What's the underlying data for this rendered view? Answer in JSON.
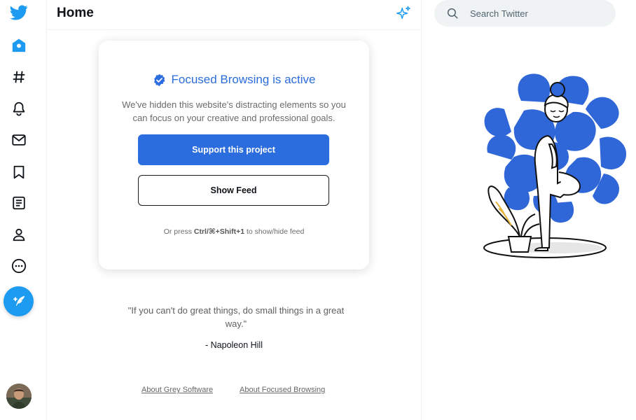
{
  "sidebar": {
    "icons": [
      "twitter-logo-icon",
      "home-icon",
      "hashtag-icon",
      "bell-icon",
      "mail-icon",
      "bookmark-icon",
      "lists-icon",
      "profile-icon",
      "more-icon"
    ],
    "tweet_button_icon": "feather-plus-icon"
  },
  "header": {
    "title": "Home"
  },
  "search": {
    "placeholder": "Search Twitter"
  },
  "card": {
    "title": "Focused Browsing is active",
    "description": "We've hidden this website's distracting elements so you can focus on your creative and professional goals.",
    "primary_button": "Support this project",
    "secondary_button": "Show Feed",
    "hint_prefix": "Or press ",
    "hint_keys": "Ctrl/⌘+Shift+1",
    "hint_suffix": " to show/hide feed"
  },
  "quote": {
    "text": "\"If you can't do great things, do small things in a great way.\"",
    "author": "- Napoleon Hill"
  },
  "footer": {
    "link1": "About Grey Software",
    "link2": "About Focused Browsing"
  },
  "colors": {
    "twitter_blue": "#1d9bf0",
    "accent_blue": "#2b6cde",
    "illustration_blue": "#2f66d8"
  }
}
